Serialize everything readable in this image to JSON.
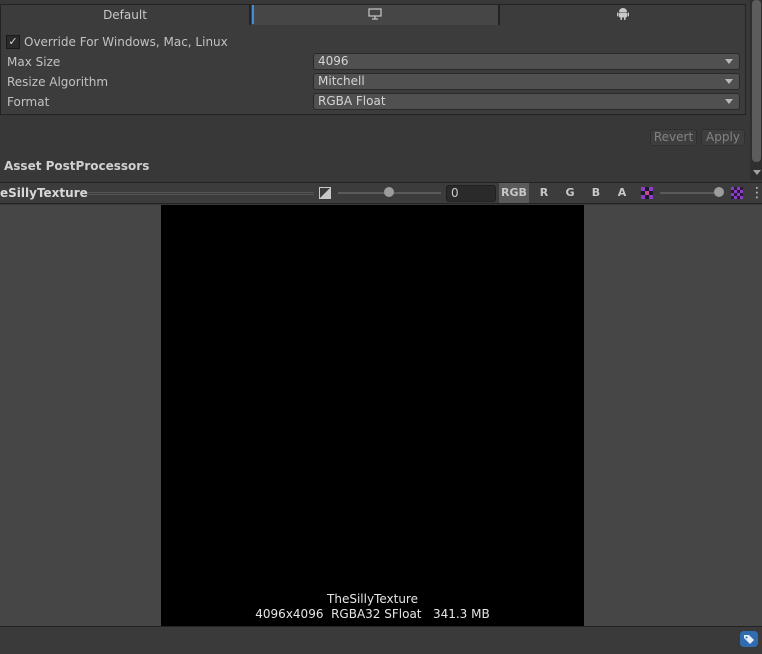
{
  "tabs": {
    "default_label": "Default",
    "standalone_icon": "monitor-icon",
    "android_icon": "android-icon"
  },
  "override": {
    "checked": true,
    "check_glyph": "✓",
    "label": "Override For Windows, Mac, Linux"
  },
  "settings": {
    "max_size_label": "Max Size",
    "max_size_value": "4096",
    "resize_label": "Resize Algorithm",
    "resize_value": "Mitchell",
    "format_label": "Format",
    "format_value": "RGBA Float"
  },
  "actions": {
    "revert_label": "Revert",
    "apply_label": "Apply"
  },
  "section": {
    "postprocessors_title": "Asset PostProcessors"
  },
  "preview": {
    "title": "eSillyTexture",
    "mip_value": "0",
    "channels": [
      "RGB",
      "R",
      "G",
      "B",
      "A"
    ],
    "active_channel": "RGB",
    "texture_name": "TheSillyTexture",
    "texture_details": "4096x4096  RGBA32 SFloat   341.3 MB"
  },
  "colors": {
    "accent": "#3a8fd6",
    "checker_purple": "#8e3cc8"
  }
}
